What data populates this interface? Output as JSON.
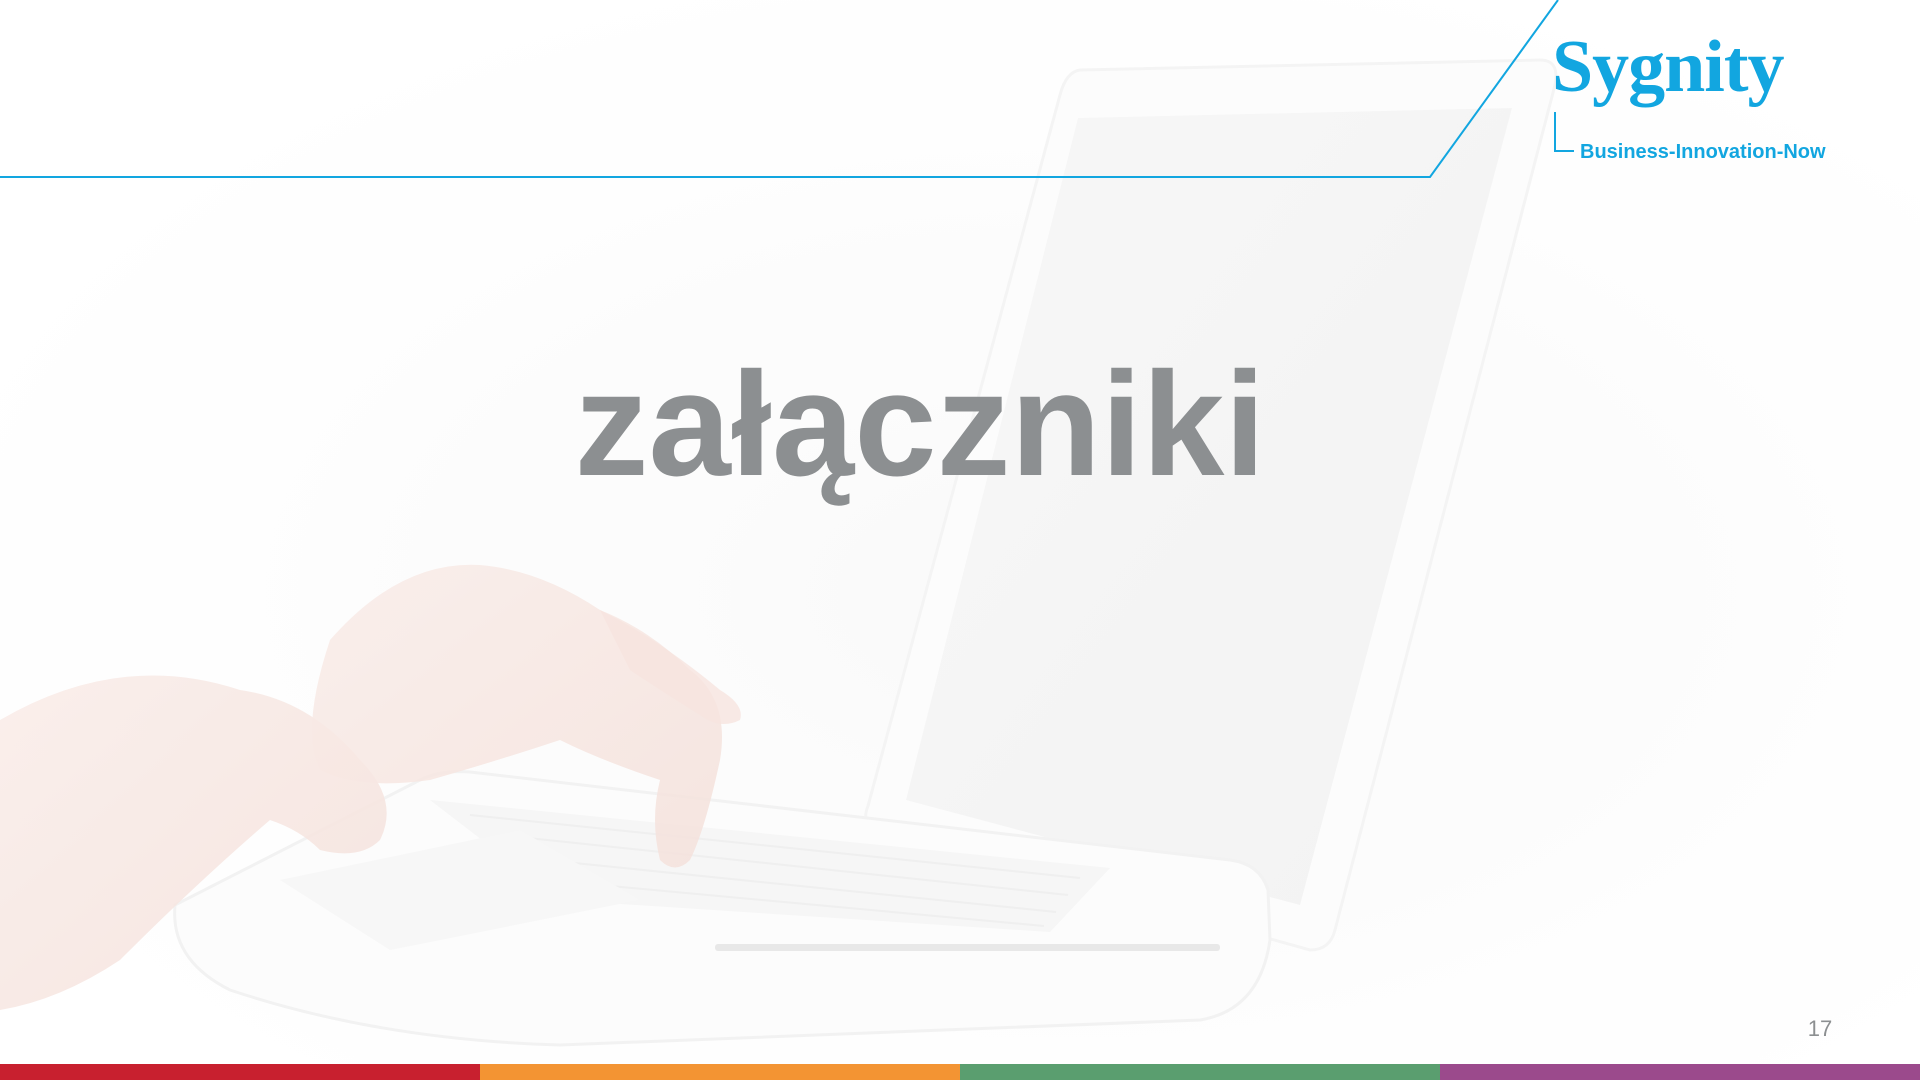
{
  "slide": {
    "title": "załączniki",
    "page_number": "17"
  },
  "logo": {
    "brand": "Sygnity",
    "tagline": "Business-Innovation-Now"
  },
  "colors": {
    "brand_blue": "#12a6e0",
    "title_gray": "#8c8f91",
    "footer_segments": [
      "#c8202f",
      "#f39433",
      "#5a9e6f",
      "#9b4a8c"
    ]
  },
  "background": {
    "image_subject": "hands-typing-on-white-laptop"
  }
}
